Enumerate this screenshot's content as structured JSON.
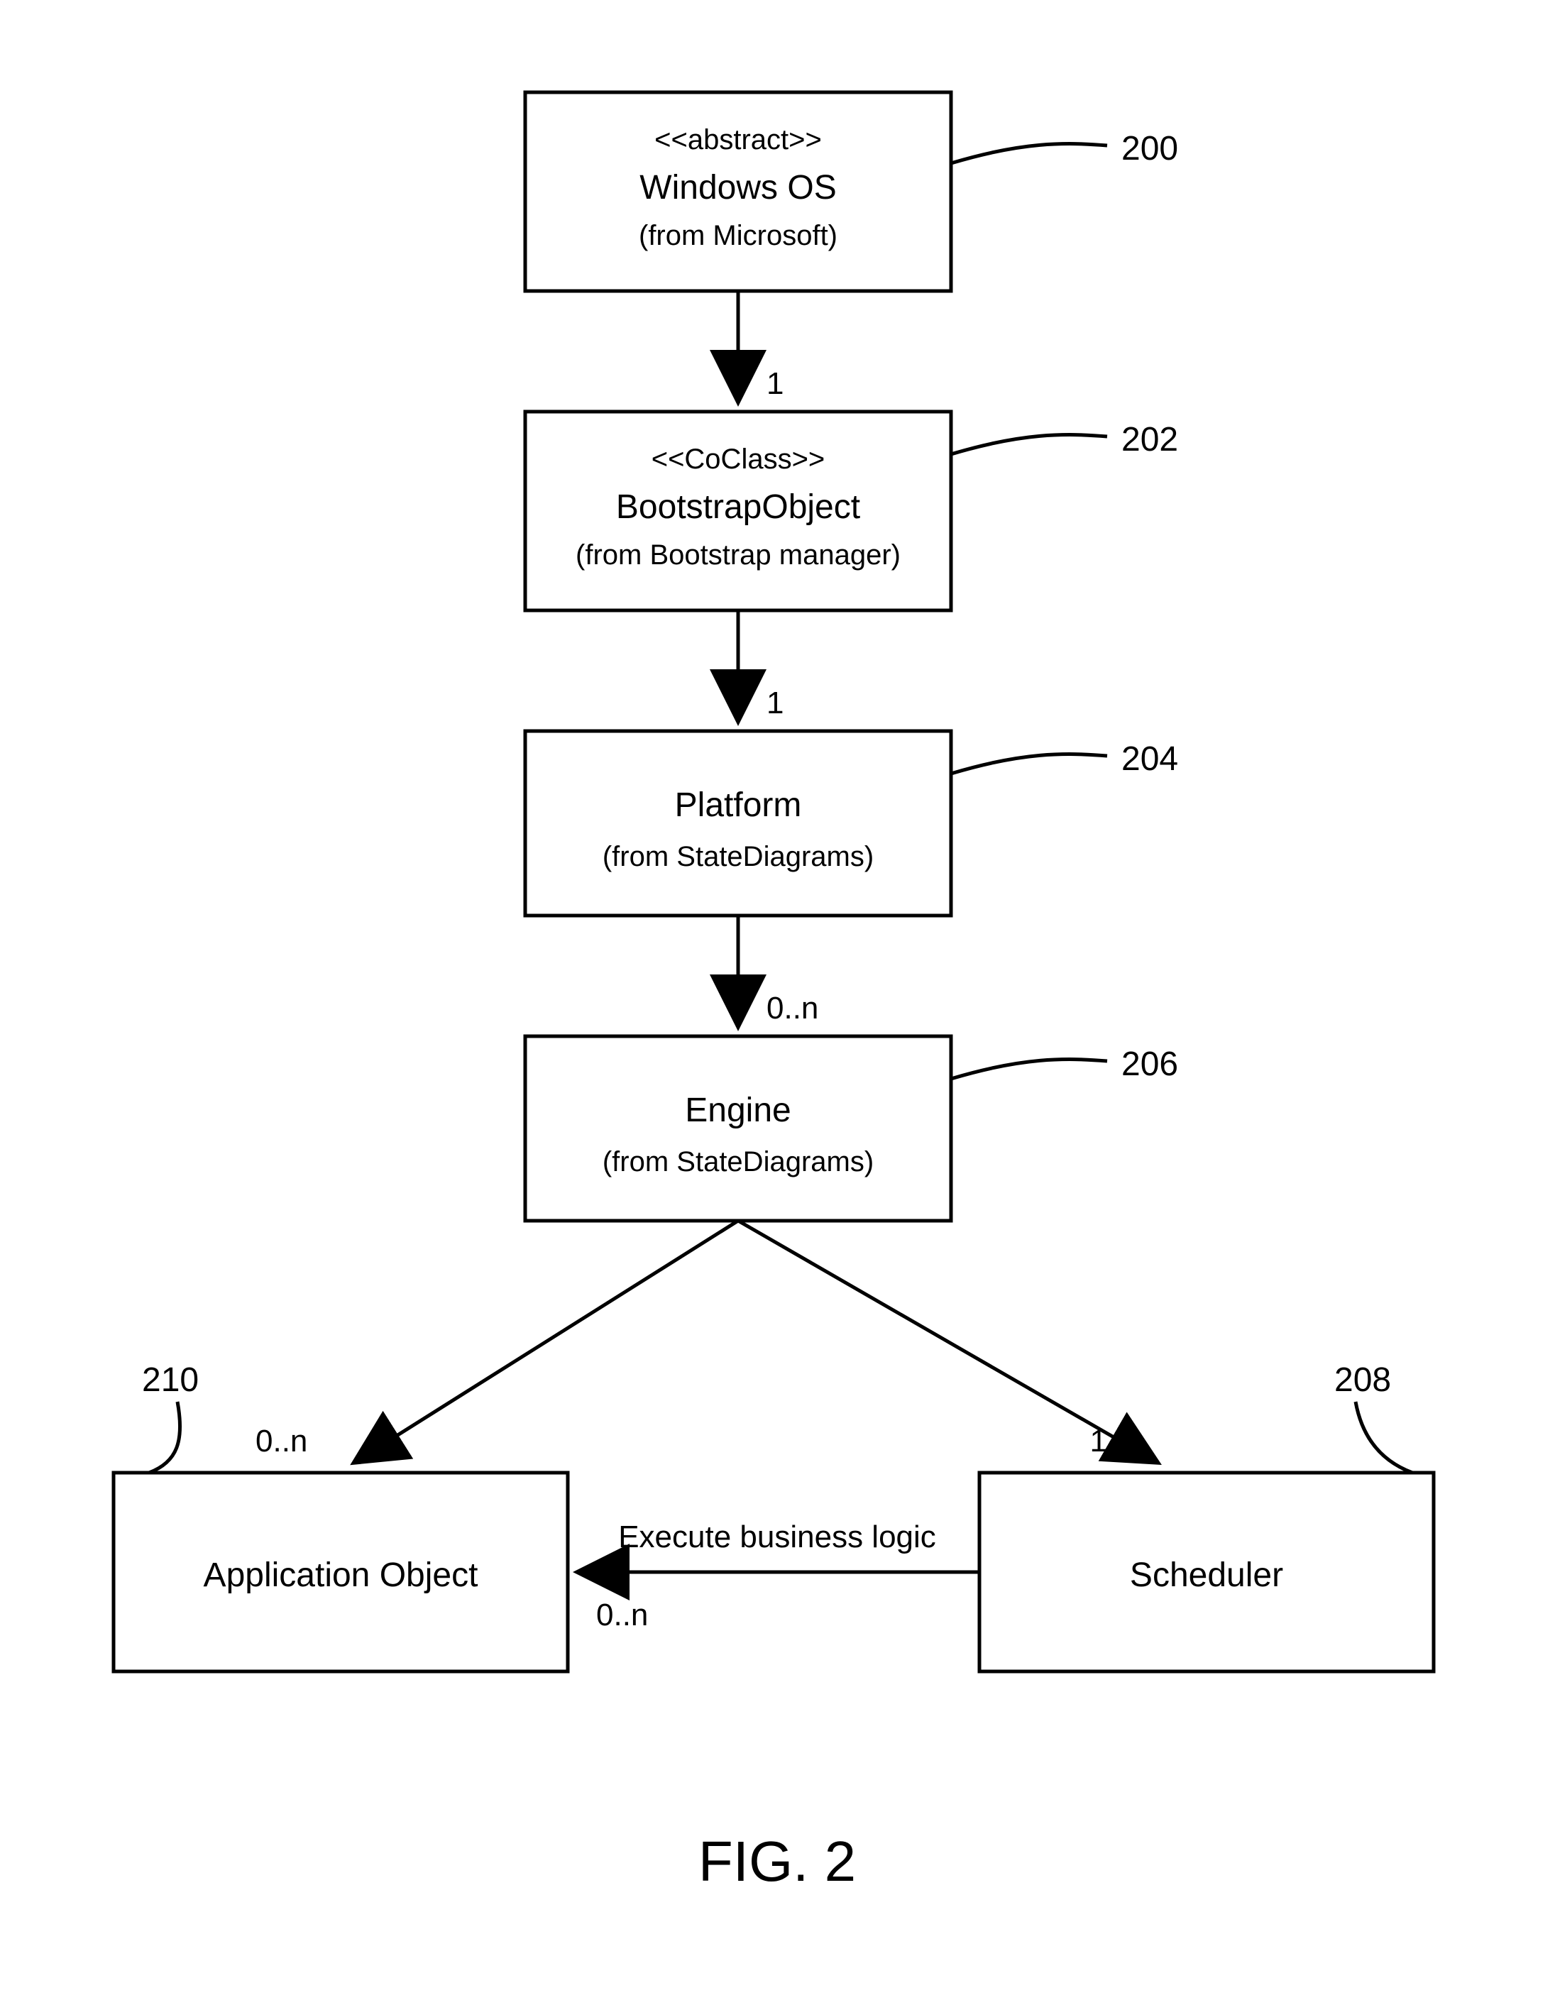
{
  "figure_title": "FIG. 2",
  "boxes": {
    "b200": {
      "stereo": "<<abstract>>",
      "name": "Windows OS",
      "sub": "(from Microsoft)",
      "num": "200"
    },
    "b202": {
      "stereo": "<<CoClass>>",
      "name": "BootstrapObject",
      "sub": "(from Bootstrap manager)",
      "num": "202"
    },
    "b204": {
      "name": "Platform",
      "sub": "(from StateDiagrams)",
      "num": "204"
    },
    "b206": {
      "name": "Engine",
      "sub": "(from StateDiagrams)",
      "num": "206"
    },
    "b208": {
      "name": "Scheduler",
      "num": "208"
    },
    "b210": {
      "name": "Application Object",
      "num": "210"
    }
  },
  "multiplicities": {
    "m1a": "1",
    "m1b": "1",
    "m0n_a": "0..n",
    "m0n_b": "0..n",
    "m1c": "1",
    "m0n_c": "0..n"
  },
  "edge_label": "Execute business logic"
}
